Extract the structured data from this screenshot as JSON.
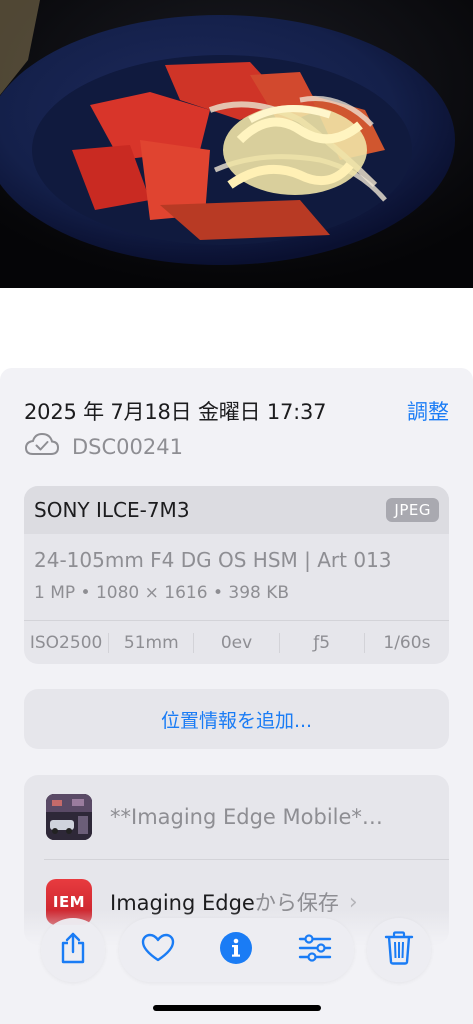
{
  "photo": {
    "subject": "salad-bowl-photo"
  },
  "info": {
    "date": "2025 年 7月18日 金曜日 17:37",
    "adjust_label": "調整",
    "filename": "DSC00241",
    "camera": {
      "model": "SONY ILCE-7M3",
      "format": "JPEG",
      "lens": "24-105mm F4 DG OS HSM | Art 013",
      "specs": "1 MP • 1080 × 1616 • 398 KB",
      "exif": [
        "ISO2500",
        "51mm",
        "0ev",
        "ƒ5",
        "1/60s"
      ]
    },
    "location_button": "位置情報を追加...",
    "sources": [
      {
        "label": "**Imaging Edge Mobile*…"
      },
      {
        "label_strong": "Imaging Edge",
        "label_rest": "から保存",
        "app_icon_text": "IEM"
      }
    ]
  },
  "toolbar": {
    "icons": [
      "share-icon",
      "heart-icon",
      "info-icon",
      "adjustments-icon",
      "trash-icon"
    ]
  },
  "colors": {
    "accent": "#1a7cf5",
    "panel_bg": "#f2f2f6",
    "card_bg": "#e6e6eb",
    "secondary_text": "#8e8e93"
  }
}
